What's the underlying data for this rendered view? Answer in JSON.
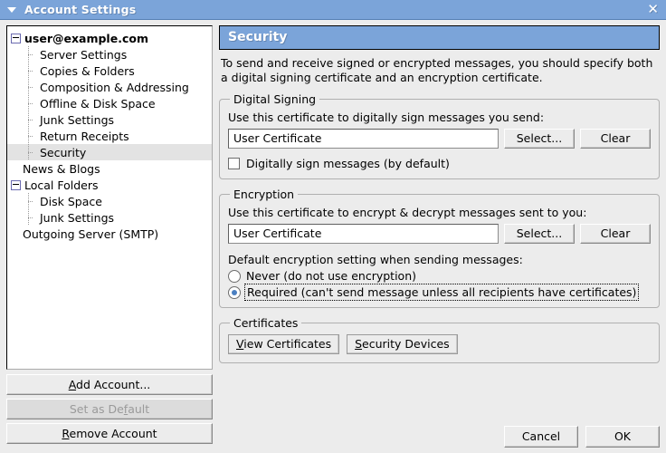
{
  "window": {
    "title": "Account Settings",
    "menu_icon": "caret-down-icon",
    "close_icon": "close-icon",
    "titlebar_color": "#7ba4d9"
  },
  "sidebar": {
    "tree": [
      {
        "label": "user@example.com",
        "level": 0,
        "expander": "minus",
        "bold": true,
        "selected": false
      },
      {
        "label": "Server Settings",
        "level": 1,
        "expander": "none",
        "bold": false,
        "selected": false
      },
      {
        "label": "Copies & Folders",
        "level": 1,
        "expander": "none",
        "bold": false,
        "selected": false
      },
      {
        "label": "Composition & Addressing",
        "level": 1,
        "expander": "none",
        "bold": false,
        "selected": false
      },
      {
        "label": "Offline & Disk Space",
        "level": 1,
        "expander": "none",
        "bold": false,
        "selected": false
      },
      {
        "label": "Junk Settings",
        "level": 1,
        "expander": "none",
        "bold": false,
        "selected": false
      },
      {
        "label": "Return Receipts",
        "level": 1,
        "expander": "none",
        "bold": false,
        "selected": false
      },
      {
        "label": "Security",
        "level": 1,
        "expander": "none",
        "bold": false,
        "selected": true
      },
      {
        "label": "News & Blogs",
        "level": 0,
        "expander": "spacer",
        "bold": false,
        "selected": false
      },
      {
        "label": "Local Folders",
        "level": 0,
        "expander": "minus",
        "bold": false,
        "selected": false
      },
      {
        "label": "Disk Space",
        "level": 1,
        "expander": "none",
        "bold": false,
        "selected": false
      },
      {
        "label": "Junk Settings",
        "level": 1,
        "expander": "none",
        "bold": false,
        "selected": false
      },
      {
        "label": "Outgoing Server (SMTP)",
        "level": 0,
        "expander": "spacer",
        "bold": false,
        "selected": false
      }
    ],
    "buttons": {
      "add_account": {
        "pre": "",
        "accel": "A",
        "post": "dd Account...",
        "disabled": false
      },
      "set_default": {
        "pre": "Set as De",
        "accel": "f",
        "post": "ault",
        "disabled": true
      },
      "remove_account": {
        "pre": "",
        "accel": "R",
        "post": "emove Account",
        "disabled": false
      }
    }
  },
  "panel": {
    "header": "Security",
    "description": "To send and receive signed or encrypted messages, you should specify both a digital signing certificate and an encryption certificate.",
    "digital_signing": {
      "legend": "Digital Signing",
      "field_label": "Use this certificate to digitally sign messages you send:",
      "certificate_value": "User Certificate",
      "certificate_placeholder": "",
      "select_button": "Select...",
      "clear_button": "Clear",
      "checkbox_label": "Digitally sign messages (by default)",
      "checkbox_checked": false
    },
    "encryption": {
      "legend": "Encryption",
      "field_label": "Use this certificate to encrypt & decrypt messages sent to you:",
      "certificate_value": "User Certificate",
      "certificate_placeholder": "",
      "select_button": "Select...",
      "clear_button": "Clear",
      "default_setting_label": "Default encryption setting when sending messages:",
      "options": [
        {
          "label": "Never (do not use encryption)",
          "selected": false,
          "focused": false
        },
        {
          "label": "Required (can't send message unless all recipients have certificates)",
          "selected": true,
          "focused": true
        }
      ]
    },
    "certificates": {
      "legend": "Certificates",
      "view_button": {
        "accel": "V",
        "post": "iew Certificates"
      },
      "devices_button": {
        "accel": "S",
        "post": "ecurity Devices"
      }
    },
    "footer": {
      "cancel": "Cancel",
      "ok": "OK"
    }
  }
}
